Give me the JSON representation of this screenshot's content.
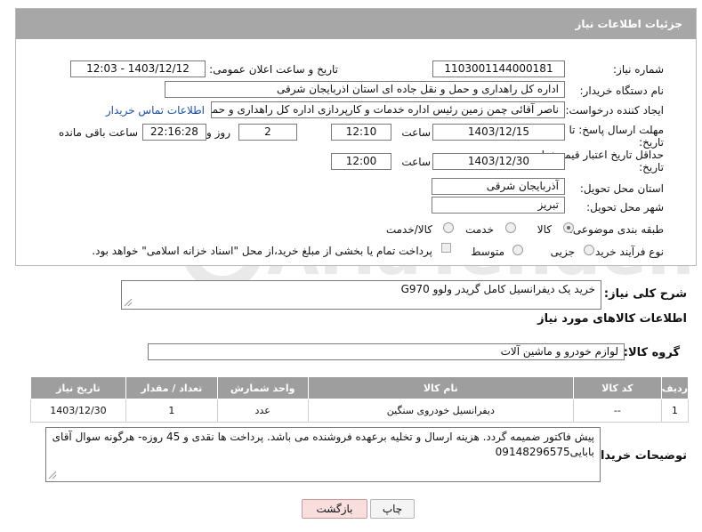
{
  "header": {
    "title": "جزئیات اطلاعات نیاز"
  },
  "form": {
    "need_number": {
      "label": "شماره نیاز:",
      "value": "1103001144000181"
    },
    "announce_datetime": {
      "label": "تاریخ و ساعت اعلان عمومی:",
      "value": "1403/12/12 - 12:03"
    },
    "buyer_org": {
      "label": "نام دستگاه خریدار:",
      "value": "اداره کل راهداری و حمل و نقل جاده ای استان اذربایجان شرقی"
    },
    "requester": {
      "label": "ایجاد کننده درخواست:",
      "value": "ناصر آقائی چمن زمین رئیس اداره خدمات و کارپردازی اداره کل راهداری و حمل و",
      "contact_link": "اطلاعات تماس خریدار"
    },
    "reply_deadline": {
      "label_line1": "مهلت ارسال پاسخ: تا",
      "label_line2": "تاریخ:",
      "date": "1403/12/15",
      "time_label": "ساعت",
      "time": "12:10",
      "days": "2",
      "days_label": "روز و",
      "remaining": "22:16:28",
      "remaining_label": "ساعت باقی مانده"
    },
    "price_validity": {
      "label_line1": "حداقل تاریخ اعتبار قیمت: تا",
      "label_line2": "تاریخ:",
      "date": "1403/12/30",
      "time_label": "ساعت",
      "time": "12:00"
    },
    "delivery_province": {
      "label": "استان محل تحویل:",
      "value": "آذربایجان شرقی"
    },
    "delivery_city": {
      "label": "شهر محل تحویل:",
      "value": "تبریز"
    },
    "category": {
      "label": "طبقه بندی موضوعی:",
      "options": [
        "کالا",
        "خدمت",
        "کالا/خدمت"
      ],
      "selected": "کالا"
    },
    "purchase_type": {
      "label": "نوع فرآیند خرید :",
      "options": [
        "جزیی",
        "متوسط"
      ],
      "selected": "",
      "treasury_note": "پرداخت تمام یا بخشی از مبلغ خرید،از محل \"اسناد خزانه اسلامی\" خواهد بود."
    }
  },
  "summary": {
    "label": "شرح کلی نیاز:",
    "value": "خرید یک دیفرانسیل کامل گریدر ولوو G970"
  },
  "goods_section": {
    "title": "اطلاعات کالاهای مورد نیاز",
    "group_label": "گروه کالا:",
    "group_value": "لوازم خودرو و ماشین آلات",
    "columns": [
      "ردیف",
      "کد کالا",
      "نام کالا",
      "واحد شمارش",
      "تعداد / مقدار",
      "تاریخ نیاز"
    ],
    "rows": [
      [
        "1",
        "--",
        "دیفرانسیل خودروی سنگین",
        "عدد",
        "1",
        "1403/12/30"
      ]
    ]
  },
  "buyer_notes": {
    "label": "توضیحات خریدار:",
    "value": "پیش فاکتور ضمیمه گردد. هزینه ارسال و تخلیه برعهده فروشنده می باشد. پرداخت ها نقدی و 45 روزه- هرگونه سوال آقای بابایی09148296575"
  },
  "buttons": {
    "print": "چاپ",
    "back": "بازگشت"
  },
  "colors": {
    "header_bg": "#a7a7a7",
    "link": "#1a4fa8",
    "back_button_bg": "#f9dede"
  }
}
